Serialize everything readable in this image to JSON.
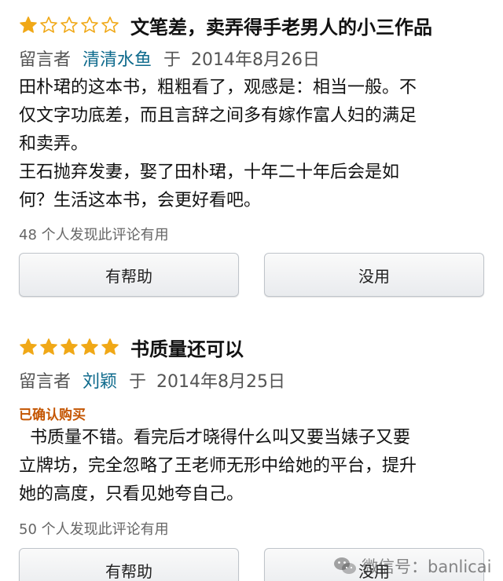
{
  "reviews": [
    {
      "rating": 1,
      "max_rating": 5,
      "title": "文笔差，卖弄得手老男人的小三作品",
      "label": "留言者",
      "author": "清清水鱼",
      "date_prefix": "于",
      "date": "2014年8月26日",
      "verified": "",
      "body": [
        "田朴珺的这本书，粗粗看了，观感是：相当一般。不",
        "仅文字功底差，而且言辞之间多有嫁作富人妇的满足",
        "和卖弄。",
        "王石抛弃发妻，娶了田朴珺，十年二十年后会是如",
        "何？生活这本书，会更好看吧。"
      ],
      "helpful_count": "48 个人发现此评论有用",
      "yes_label": "有帮助",
      "no_label": "没用"
    },
    {
      "rating": 5,
      "max_rating": 5,
      "title": "书质量还可以",
      "label": "留言者",
      "author": "刘颖",
      "date_prefix": "于",
      "date": "2014年8月25日",
      "verified": "已确认购买",
      "body": [
        "  书质量不错。看完后才晓得什么叫又要当婊子又要",
        "立牌坊，完全忽略了王老师无形中给她的平台，提升",
        "她的高度，只看见她夸自己。"
      ],
      "helpful_count": "50 个人发现此评论有用",
      "yes_label": "有帮助",
      "no_label": "没用"
    }
  ],
  "watermark": {
    "text": "微信号：banlicai",
    "icon": "wechat-icon"
  },
  "colors": {
    "star_filled": "#f0a817",
    "star_empty": "#f0a817",
    "author_link": "#0e6a8c",
    "verified": "#c45500"
  }
}
